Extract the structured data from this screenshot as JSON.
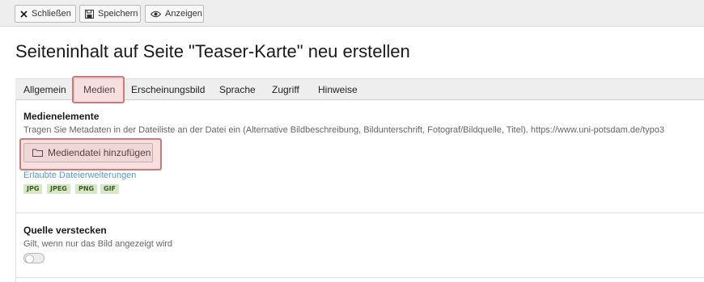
{
  "toolbar": {
    "close_label": "Schließen",
    "save_label": "Speichern",
    "view_label": "Anzeigen"
  },
  "page_title": "Seiteninhalt auf Seite \"Teaser-Karte\" neu erstellen",
  "tabs": [
    {
      "label": "Allgemein",
      "active": false
    },
    {
      "label": "Medien",
      "active": true
    },
    {
      "label": "Erscheinungsbild",
      "active": false
    },
    {
      "label": "Sprache",
      "active": false
    },
    {
      "label": "Zugriff",
      "active": false
    },
    {
      "label": "Hinweise",
      "active": false
    }
  ],
  "media_section": {
    "title": "Medienelemente",
    "description": "Tragen Sie Metadaten in der Dateiliste an der Datei ein (Alternative Bildbeschreibung, Bildunterschrift, Fotograf/Bildquelle, Titel). https://www.uni-potsdam.de/typo3",
    "add_button_label": "Mediendatei hinzufügen",
    "allowed_extensions_label": "Erlaubte Dateierweiterungen",
    "extensions": [
      "JPG",
      "JPEG",
      "PNG",
      "GIF"
    ]
  },
  "hide_source_section": {
    "title": "Quelle verstecken",
    "description": "Gilt, wenn nur das Bild angezeigt wird",
    "toggle_checked": false
  },
  "colors": {
    "highlight": "#cc7a7a",
    "link": "#5a9ad6",
    "extension_badge_bg": "#d7e8c8"
  }
}
